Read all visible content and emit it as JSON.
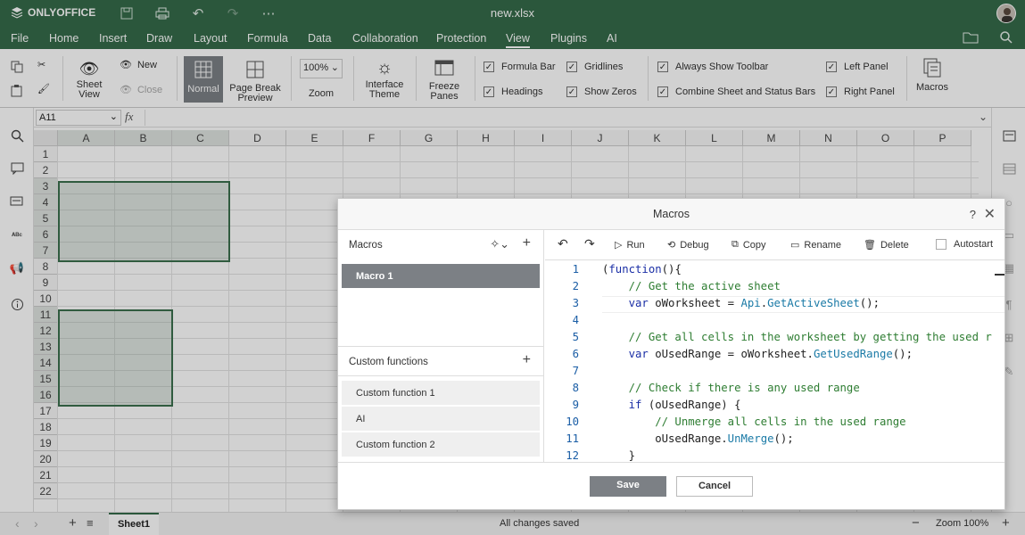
{
  "app": {
    "brand": "ONLYOFFICE",
    "doc_title": "new.xlsx"
  },
  "menu": [
    "File",
    "Home",
    "Insert",
    "Draw",
    "Layout",
    "Formula",
    "Data",
    "Collaboration",
    "Protection",
    "View",
    "Plugins",
    "AI"
  ],
  "menu_active": "View",
  "ribbon": {
    "new": "New",
    "close": "Close",
    "sheet_view": "Sheet View",
    "normal": "Normal",
    "page_break": "Page Break Preview",
    "zoom_value": "100%",
    "zoom": "Zoom",
    "interface_theme": "Interface Theme",
    "freeze_panes": "Freeze Panes",
    "formula_bar": "Formula Bar",
    "headings": "Headings",
    "gridlines": "Gridlines",
    "show_zeros": "Show Zeros",
    "always_show_toolbar": "Always Show Toolbar",
    "combine_bars": "Combine Sheet and Status Bars",
    "left_panel": "Left Panel",
    "right_panel": "Right Panel",
    "macros": "Macros"
  },
  "formula_bar": {
    "cell": "A11",
    "fx": "fx"
  },
  "columns": [
    "A",
    "B",
    "C",
    "D",
    "E",
    "F",
    "G",
    "H",
    "I",
    "J",
    "K",
    "L",
    "M",
    "N",
    "O",
    "P"
  ],
  "rows": [
    "1",
    "2",
    "3",
    "4",
    "5",
    "6",
    "7",
    "8",
    "9",
    "10",
    "11",
    "12",
    "13",
    "14",
    "15",
    "16",
    "17",
    "18",
    "19",
    "20",
    "21",
    "22"
  ],
  "status": {
    "sheet": "Sheet1",
    "message": "All changes saved",
    "zoom": "Zoom 100%"
  },
  "dialog": {
    "title": "Macros",
    "help": "?",
    "macros_header": "Macros",
    "macros": [
      "Macro 1"
    ],
    "custom_header": "Custom functions",
    "custom": [
      "Custom function 1",
      "AI",
      "Custom function 2"
    ],
    "toolbar": {
      "run": "Run",
      "debug": "Debug",
      "copy": "Copy",
      "rename": "Rename",
      "delete": "Delete",
      "autostart": "Autostart"
    },
    "code_lines": [
      {
        "n": "1",
        "t": "(function(){"
      },
      {
        "n": "2",
        "t": "    // Get the active sheet"
      },
      {
        "n": "3",
        "t": "    var oWorksheet = Api.GetActiveSheet();"
      },
      {
        "n": "4",
        "t": ""
      },
      {
        "n": "5",
        "t": "    // Get all cells in the worksheet by getting the used r"
      },
      {
        "n": "6",
        "t": "    var oUsedRange = oWorksheet.GetUsedRange();"
      },
      {
        "n": "7",
        "t": ""
      },
      {
        "n": "8",
        "t": "    // Check if there is any used range"
      },
      {
        "n": "9",
        "t": "    if (oUsedRange) {"
      },
      {
        "n": "10",
        "t": "        // Unmerge all cells in the used range"
      },
      {
        "n": "11",
        "t": "        oUsedRange.UnMerge();"
      },
      {
        "n": "12",
        "t": "    }"
      }
    ],
    "save": "Save",
    "cancel": "Cancel"
  }
}
